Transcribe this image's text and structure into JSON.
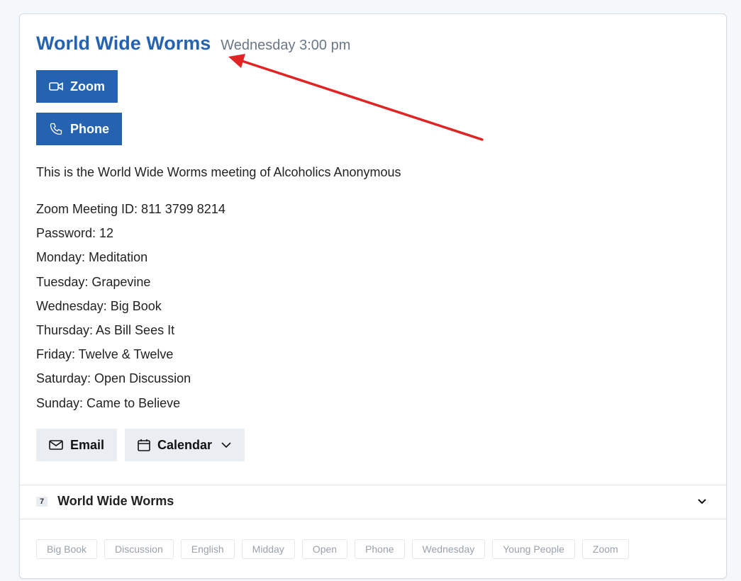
{
  "meeting": {
    "title": "World Wide Worms",
    "time": "Wednesday 3:00 pm"
  },
  "buttons": {
    "zoom_label": "Zoom",
    "phone_label": "Phone",
    "email_label": "Email",
    "calendar_label": "Calendar"
  },
  "icons": {
    "zoom": "video-camera-icon",
    "phone": "phone-icon",
    "email": "envelope-icon",
    "calendar": "calendar-icon",
    "calendar_dropdown": "chevron-down-icon",
    "group_toggle": "chevron-down-icon"
  },
  "description": "This is the World Wide Worms meeting of Alcoholics Anonymous",
  "details": [
    "Zoom Meeting ID: 811 3799 8214",
    "Password: 12",
    "Monday: Meditation",
    "Tuesday: Grapevine",
    "Wednesday: Big Book",
    "Thursday: As Bill Sees It",
    "Friday: Twelve & Twelve",
    "Saturday: Open Discussion",
    "Sunday: Came to Believe"
  ],
  "group": {
    "count": "7",
    "name": "World Wide Worms"
  },
  "tags": [
    "Big Book",
    "Discussion",
    "English",
    "Midday",
    "Open",
    "Phone",
    "Wednesday",
    "Young People",
    "Zoom"
  ],
  "colors": {
    "primary": "#2563b0",
    "annotation_arrow": "#e02424",
    "secondary_button": "#eaeef2"
  }
}
